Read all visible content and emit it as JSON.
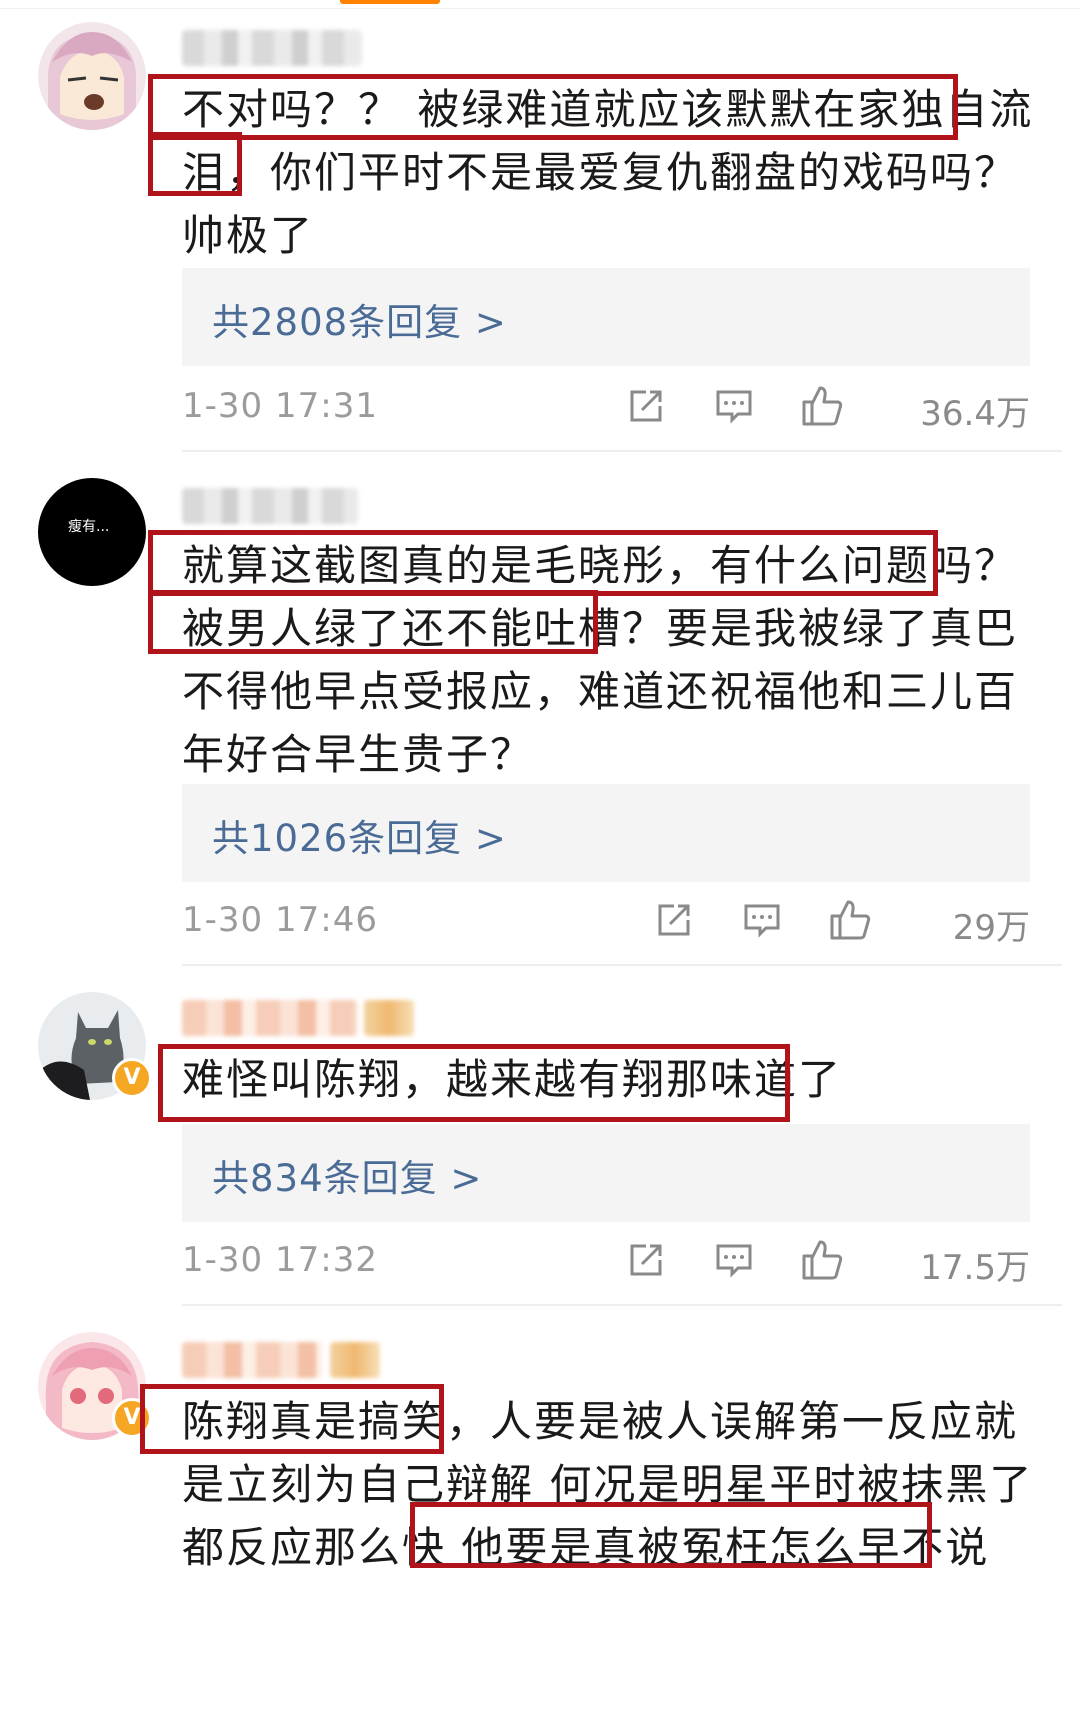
{
  "comments": [
    {
      "lines": [
        "不对吗？？ 被绿难道就应该默默在家独自流",
        "泪，你们平时不是最爱复仇翻盘的戏码吗？",
        "帅极了"
      ],
      "replies": "共2808条回复 >",
      "time": "1-30 17:31",
      "likes": "36.4万",
      "avatar_icon": "anime-avatar-icon"
    },
    {
      "lines": [
        "就算这截图真的是毛晓彤，有什么问题吗？",
        "被男人绿了还不能吐槽？要是我被绿了真巴",
        "不得他早点受报应，难道还祝福他和三儿百",
        "年好合早生贵子？"
      ],
      "replies": "共1026条回复 >",
      "time": "1-30 17:46",
      "likes": "29万",
      "avatar_icon": "black-text-avatar-icon",
      "avatar_text": "瘦有..."
    },
    {
      "lines": [
        "难怪叫陈翔，越来越有翔那味道了"
      ],
      "replies": "共834条回复 >",
      "time": "1-30 17:32",
      "likes": "17.5万",
      "avatar_icon": "cat-avatar-icon",
      "verified": "V"
    },
    {
      "lines": [
        "陈翔真是搞笑，人要是被人误解第一反应就",
        "是立刻为自己辩解 何况是明星平时被抹黑了",
        "都反应那么快 他要是真被冤枉怎么早不说"
      ],
      "avatar_icon": "pink-anime-avatar-icon",
      "verified": "V"
    }
  ],
  "colors": {
    "highlight": "#b1131b",
    "link": "#4a6b96",
    "meta": "#9b9b9b",
    "reply_bg": "#f4f4f4",
    "verified": "#f5a623"
  }
}
